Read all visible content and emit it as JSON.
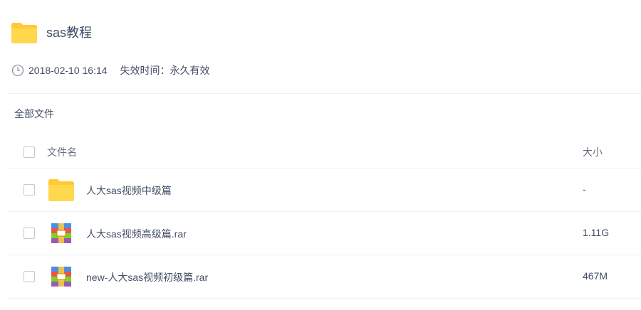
{
  "share": {
    "title": "sas教程",
    "date": "2018-02-10 16:14",
    "expiry": "失效时间：永久有效"
  },
  "breadcrumb": "全部文件",
  "list_header": {
    "name_label": "文件名",
    "size_label": "大小"
  },
  "files": [
    {
      "name": "人大sas视频中级篇",
      "size": "-",
      "type": "folder"
    },
    {
      "name": "人大sas视频高级篇.rar",
      "size": "1.11G",
      "type": "rar"
    },
    {
      "name": "new-人大sas视频初级篇.rar",
      "size": "467M",
      "type": "rar"
    }
  ],
  "colors": {
    "folder": "#ffd24a",
    "text": "#424e67",
    "divider": "#eef1f5"
  }
}
